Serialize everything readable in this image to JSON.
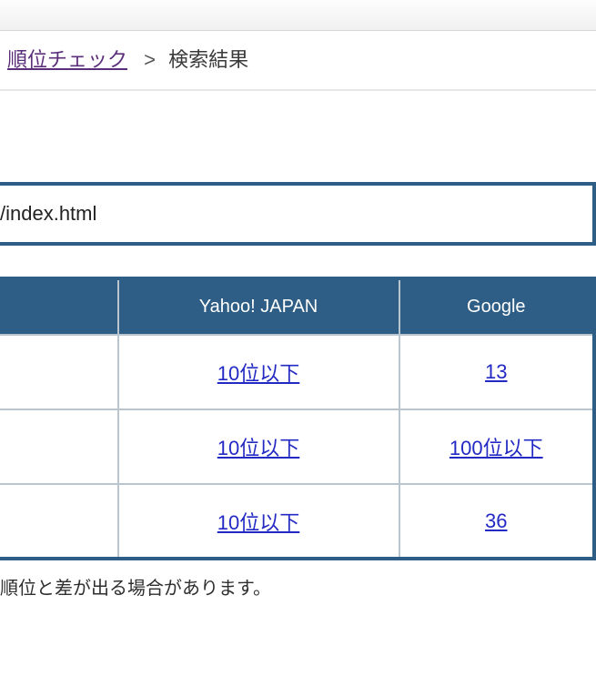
{
  "breadcrumb": {
    "link_label": "順位チェック",
    "separator": ">",
    "current": "検索結果"
  },
  "url_fragment": "/index.html",
  "table": {
    "headers": {
      "left": "",
      "yahoo": "Yahoo! JAPAN",
      "google": "Google"
    },
    "rows": [
      {
        "left": "",
        "yahoo": "10位以下",
        "google": "13"
      },
      {
        "left": "",
        "yahoo": "10位以下",
        "google": "100位以下"
      },
      {
        "left": "",
        "yahoo": "10位以下",
        "google": "36"
      }
    ]
  },
  "footnote": "順位と差が出る場合があります。"
}
